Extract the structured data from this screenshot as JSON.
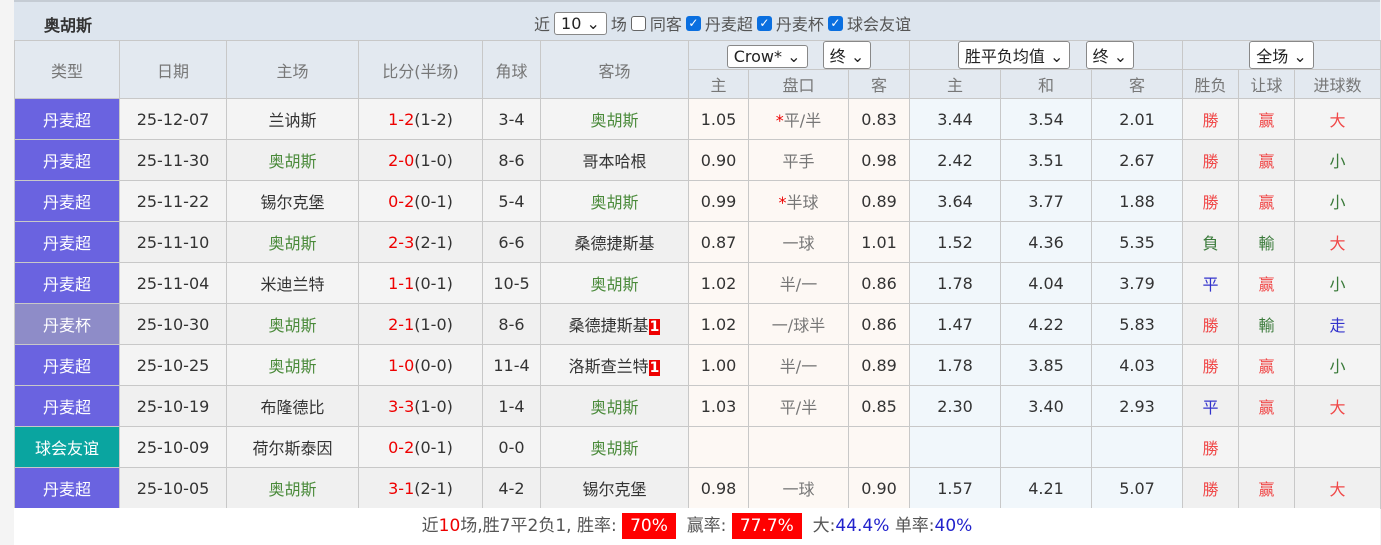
{
  "header": {
    "title": "奥胡斯",
    "recent_prefix": "近",
    "recent_count": "10",
    "recent_suffix": "场",
    "same_venue": "同客",
    "filters": [
      "丹麦超",
      "丹麦杯",
      "球会友谊"
    ]
  },
  "columns": {
    "type": "类型",
    "date": "日期",
    "home": "主场",
    "score": "比分(半场)",
    "corner": "角球",
    "away": "客场",
    "odds_company": "Crow*",
    "odds_phase": "终",
    "avg_select": "胜平负均值",
    "avg_phase": "终",
    "scope": "全场",
    "sub": [
      "主",
      "盘口",
      "客",
      "主",
      "和",
      "客",
      "胜负",
      "让球",
      "进球数"
    ]
  },
  "colors": {
    "league_super": "#6a63e0",
    "league_cup": "#8e8cc8",
    "league_friendly": "#0aa5a0",
    "red": "#ee0000"
  },
  "rows": [
    {
      "type": "丹麦超",
      "cls": "t-sl",
      "date": "25-12-07",
      "home": "兰讷斯",
      "hg": false,
      "s1": "1-2",
      "ht": "(1-2)",
      "corner": "3-4",
      "away": "奥胡斯",
      "ag": true,
      "card": "",
      "o1": "1.05",
      "hcp": "平/半",
      "star": "*",
      "o2": "0.83",
      "a1": "3.44",
      "a2": "3.54",
      "a3": "2.01",
      "r": "勝",
      "rc": "w",
      "h": "赢",
      "hc": "w",
      "g": "大",
      "gc": "w"
    },
    {
      "type": "丹麦超",
      "cls": "t-sl",
      "date": "25-11-30",
      "home": "奥胡斯",
      "hg": true,
      "s1": "2-0",
      "ht": "(1-0)",
      "corner": "8-6",
      "away": "哥本哈根",
      "ag": false,
      "card": "",
      "o1": "0.90",
      "hcp": "平手",
      "star": "",
      "o2": "0.98",
      "a1": "2.42",
      "a2": "3.51",
      "a3": "2.67",
      "r": "勝",
      "rc": "w",
      "h": "赢",
      "hc": "w",
      "g": "小",
      "gc": "l"
    },
    {
      "type": "丹麦超",
      "cls": "t-sl",
      "date": "25-11-22",
      "home": "锡尔克堡",
      "hg": false,
      "s1": "0-2",
      "ht": "(0-1)",
      "corner": "5-4",
      "away": "奥胡斯",
      "ag": true,
      "card": "",
      "o1": "0.99",
      "hcp": "半球",
      "star": "*",
      "o2": "0.89",
      "a1": "3.64",
      "a2": "3.77",
      "a3": "1.88",
      "r": "勝",
      "rc": "w",
      "h": "赢",
      "hc": "w",
      "g": "小",
      "gc": "l"
    },
    {
      "type": "丹麦超",
      "cls": "t-sl",
      "date": "25-11-10",
      "home": "奥胡斯",
      "hg": true,
      "s1": "2-3",
      "ht": "(2-1)",
      "corner": "6-6",
      "away": "桑德捷斯基",
      "ag": false,
      "card": "",
      "o1": "0.87",
      "hcp": "一球",
      "star": "",
      "o2": "1.01",
      "a1": "1.52",
      "a2": "4.36",
      "a3": "5.35",
      "r": "負",
      "rc": "l",
      "h": "輸",
      "hc": "l",
      "g": "大",
      "gc": "w"
    },
    {
      "type": "丹麦超",
      "cls": "t-sl",
      "date": "25-11-04",
      "home": "米迪兰特",
      "hg": false,
      "s1": "1-1",
      "ht": "(0-1)",
      "corner": "10-5",
      "away": "奥胡斯",
      "ag": true,
      "card": "",
      "o1": "1.02",
      "hcp": "半/一",
      "star": "",
      "o2": "0.86",
      "a1": "1.78",
      "a2": "4.04",
      "a3": "3.79",
      "r": "平",
      "rc": "d",
      "h": "赢",
      "hc": "w",
      "g": "小",
      "gc": "l"
    },
    {
      "type": "丹麦杯",
      "cls": "t-cup",
      "date": "25-10-30",
      "home": "奥胡斯",
      "hg": true,
      "s1": "2-1",
      "ht": "(1-0)",
      "corner": "8-6",
      "away": "桑德捷斯基",
      "ag": false,
      "card": "1",
      "o1": "1.02",
      "hcp": "一/球半",
      "star": "",
      "o2": "0.86",
      "a1": "1.47",
      "a2": "4.22",
      "a3": "5.83",
      "r": "勝",
      "rc": "w",
      "h": "輸",
      "hc": "l",
      "g": "走",
      "gc": "d"
    },
    {
      "type": "丹麦超",
      "cls": "t-sl",
      "date": "25-10-25",
      "home": "奥胡斯",
      "hg": true,
      "s1": "1-0",
      "ht": "(0-0)",
      "corner": "11-4",
      "away": "洛斯查兰特",
      "ag": false,
      "card": "1",
      "o1": "1.00",
      "hcp": "半/一",
      "star": "",
      "o2": "0.89",
      "a1": "1.78",
      "a2": "3.85",
      "a3": "4.03",
      "r": "勝",
      "rc": "w",
      "h": "赢",
      "hc": "w",
      "g": "小",
      "gc": "l"
    },
    {
      "type": "丹麦超",
      "cls": "t-sl",
      "date": "25-10-19",
      "home": "布隆德比",
      "hg": false,
      "s1": "3-3",
      "ht": "(1-0)",
      "corner": "1-4",
      "away": "奥胡斯",
      "ag": true,
      "card": "",
      "o1": "1.03",
      "hcp": "平/半",
      "star": "",
      "o2": "0.85",
      "a1": "2.30",
      "a2": "3.40",
      "a3": "2.93",
      "r": "平",
      "rc": "d",
      "h": "赢",
      "hc": "w",
      "g": "大",
      "gc": "w"
    },
    {
      "type": "球会友谊",
      "cls": "t-fr",
      "date": "25-10-09",
      "home": "荷尔斯泰因",
      "hg": false,
      "s1": "0-2",
      "ht": "(0-1)",
      "corner": "0-0",
      "away": "奥胡斯",
      "ag": true,
      "card": "",
      "o1": "",
      "hcp": "",
      "star": "",
      "o2": "",
      "a1": "",
      "a2": "",
      "a3": "",
      "r": "勝",
      "rc": "w",
      "h": "",
      "hc": "w",
      "g": "",
      "gc": "w"
    },
    {
      "type": "丹麦超",
      "cls": "t-sl",
      "date": "25-10-05",
      "home": "奥胡斯",
      "hg": true,
      "s1": "3-1",
      "ht": "(2-1)",
      "corner": "4-2",
      "away": "锡尔克堡",
      "ag": false,
      "card": "",
      "o1": "0.98",
      "hcp": "一球",
      "star": "",
      "o2": "0.90",
      "a1": "1.57",
      "a2": "4.21",
      "a3": "5.07",
      "r": "勝",
      "rc": "w",
      "h": "赢",
      "hc": "w",
      "g": "大",
      "gc": "w"
    }
  ],
  "footer": {
    "p1": "近",
    "n": "10",
    "p2": "场,胜7平2负1, 胜率:",
    "win_rate": "70%",
    "p3": "赢率:",
    "cover_rate": "77.7%",
    "p4": "大:",
    "over_rate": "44.4%",
    "p5": "单率:",
    "odd_rate": "40%"
  }
}
